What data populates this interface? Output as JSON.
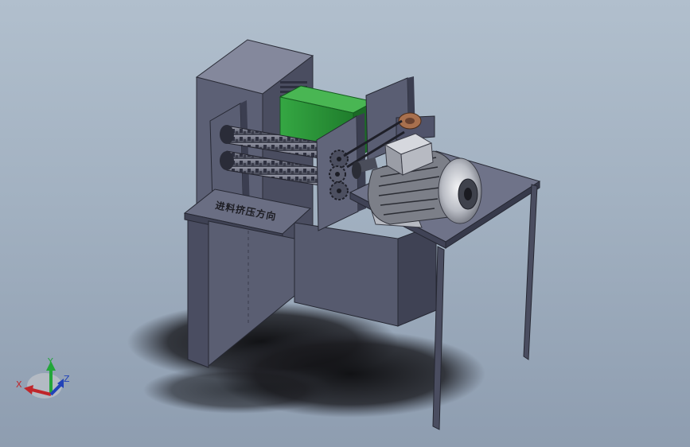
{
  "model": {
    "feed_label": "进料挤压方向"
  },
  "triad": {
    "x_label": "X",
    "y_label": "Y",
    "z_label": "Z",
    "colors": {
      "x": "#c0262a",
      "y": "#23a63a",
      "z": "#2243b8"
    }
  },
  "colors": {
    "frame": "#5b5f74",
    "frame_light": "#73778c",
    "frame_dark": "#3f4254",
    "green_block": "#2e9a3a",
    "copper_gear": "#a8704e",
    "motor": "#7c7f88",
    "motor_light": "#c9ccd2"
  }
}
